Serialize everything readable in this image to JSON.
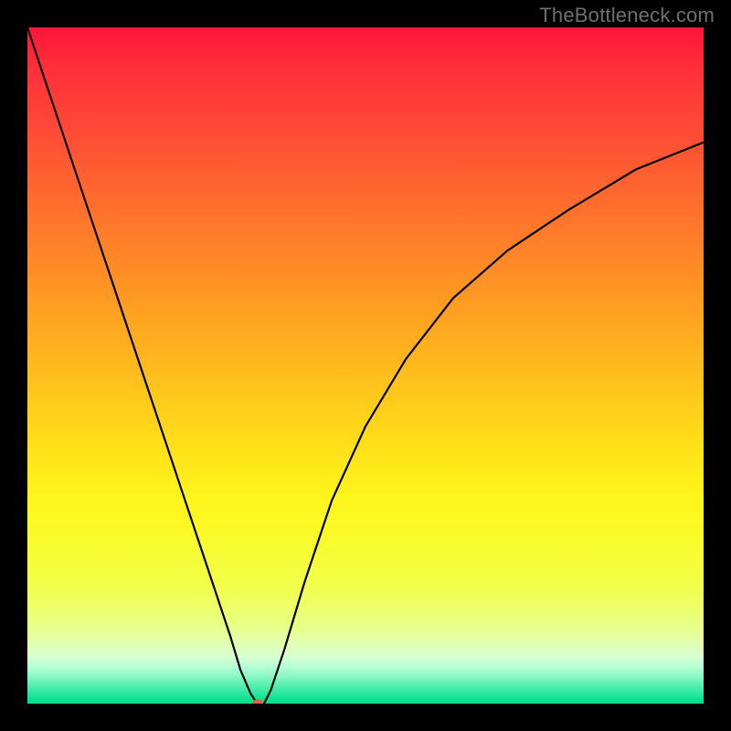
{
  "watermark": "TheBottleneck.com",
  "chart_data": {
    "type": "line",
    "title": "",
    "xlabel": "",
    "ylabel": "",
    "description": "Bottleneck curve with sharp minimum over rainbow gradient (red=high, green=low)",
    "x_range": [
      0,
      100
    ],
    "y_range": [
      0,
      100
    ],
    "minimum": {
      "x": 34,
      "y": 0
    },
    "series": [
      {
        "name": "bottleneck",
        "x": [
          0,
          3,
          6,
          9,
          12,
          15,
          18,
          21,
          24,
          27,
          30,
          31.5,
          33,
          34,
          35,
          36,
          38,
          41,
          45,
          50,
          56,
          63,
          71,
          80,
          90,
          100
        ],
        "y": [
          100,
          91,
          82,
          73,
          64,
          55,
          46,
          37,
          28,
          19,
          10,
          5,
          1.5,
          0,
          0,
          2,
          8,
          18,
          30,
          41,
          51,
          60,
          67,
          73,
          79,
          83
        ]
      }
    ],
    "gradient_stops": [
      {
        "pos": 0,
        "color": "#ff153a"
      },
      {
        "pos": 50,
        "color": "#ffc61b"
      },
      {
        "pos": 80,
        "color": "#f2ff48"
      },
      {
        "pos": 100,
        "color": "#00df8b"
      }
    ],
    "marker": {
      "type": "ellipse",
      "color": "#d6654e",
      "at": "minimum"
    }
  }
}
